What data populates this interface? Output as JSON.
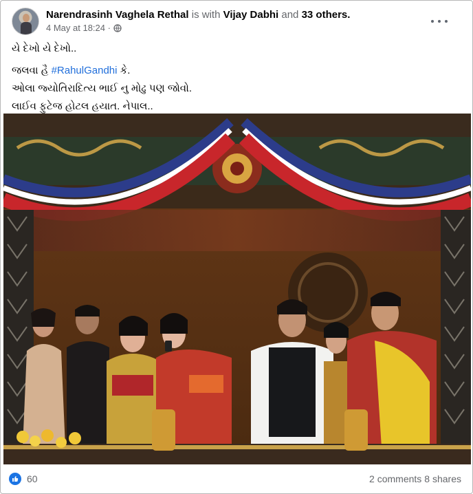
{
  "post": {
    "author": "Narendrasinh Vaghela Rethal",
    "with_word": "is with",
    "tagged_name": "Vijay Dabhi",
    "and_word": "and",
    "others": "33 others.",
    "timestamp": "4 May at 18:24 ·",
    "privacy_icon": "globe-icon",
    "menu_icon": "more-options-icon"
  },
  "text": {
    "line1": "યે દેખો યે દેખો..",
    "line2_prefix": "જલવા હૈ ",
    "line2_hashtag": "#RahulGandhi",
    "line2_suffix": " કે.",
    "line3": "ઓલા જ્યોતિરાદિત્ય ભાઈ નુ મોઢુ પણ જોવો.",
    "line4": "લાઈવ ફુટેજ હોટલ હયાત. નેપાલ.."
  },
  "photo": {
    "icon": "photo-image"
  },
  "footer": {
    "reaction_icon": "like-icon",
    "reaction_color": "#1b74e4",
    "reaction_count": "60",
    "comments": "2 comments",
    "shares": "8 shares"
  },
  "colors": {
    "link": "#216fdb",
    "meta": "#65676b"
  }
}
